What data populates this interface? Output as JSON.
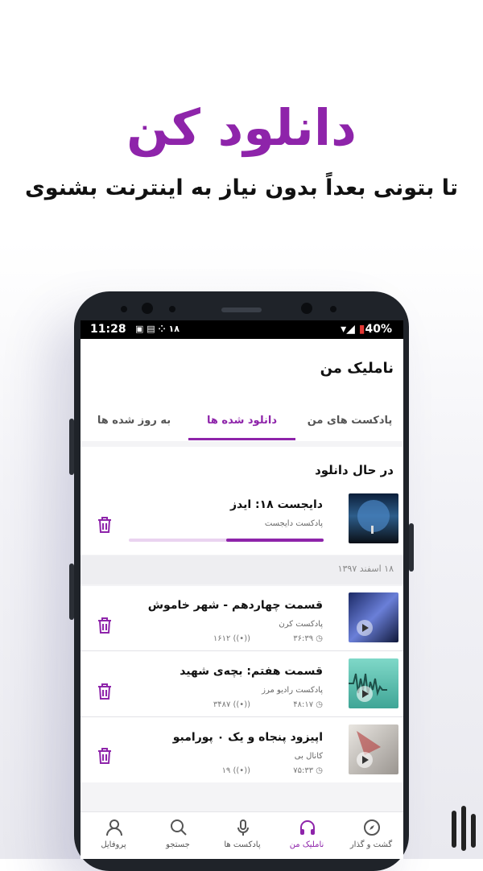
{
  "promo": {
    "headline": "دانلود کن",
    "subline": "تا بتونی بعداً بدون نیاز به اینترنت بشنوی"
  },
  "status_bar": {
    "time": "11:28",
    "notification_text": "۱۸",
    "battery": "40%"
  },
  "app": {
    "title": "نامليک من",
    "tabs": [
      {
        "label": "پادکست های من",
        "active": false
      },
      {
        "label": "دانلود شده ها",
        "active": true
      },
      {
        "label": "به روز شده ها",
        "active": false
      }
    ]
  },
  "downloading": {
    "section_title": "در حال دانلود",
    "item": {
      "title": "دایجست ۱۸: ایدز",
      "podcast": "پادکست دایجست",
      "progress": 0.5
    }
  },
  "downloaded": {
    "date_label": "۱۸ اسفند ۱۳۹۷",
    "items": [
      {
        "title": "قسمت چهاردهم - شهر خاموش",
        "podcast": "پادکست کرن",
        "duration": "۳۶:۳۹",
        "listens": "۱۶۱۲"
      },
      {
        "title": "قسمت هفتم: بچه‌ی شهید",
        "podcast": "پادکست رادیو مرز",
        "duration": "۴۸:۱۷",
        "listens": "۳۴۸۷"
      },
      {
        "title": "اپیزود پنجاه و یک ۰ پورامبو",
        "podcast": "کانال بی",
        "duration": "۷۵:۳۳",
        "listens": "۱۹"
      }
    ]
  },
  "bottom_nav": [
    {
      "label": "گشت و گذار",
      "icon": "compass-icon",
      "active": false
    },
    {
      "label": "نامليک من",
      "icon": "headphones-icon",
      "active": true
    },
    {
      "label": "پادکست ها",
      "icon": "microphone-icon",
      "active": false
    },
    {
      "label": "جستجو",
      "icon": "search-icon",
      "active": false
    },
    {
      "label": "پروفایل",
      "icon": "user-icon",
      "active": false
    }
  ],
  "colors": {
    "accent": "#8e24aa"
  }
}
